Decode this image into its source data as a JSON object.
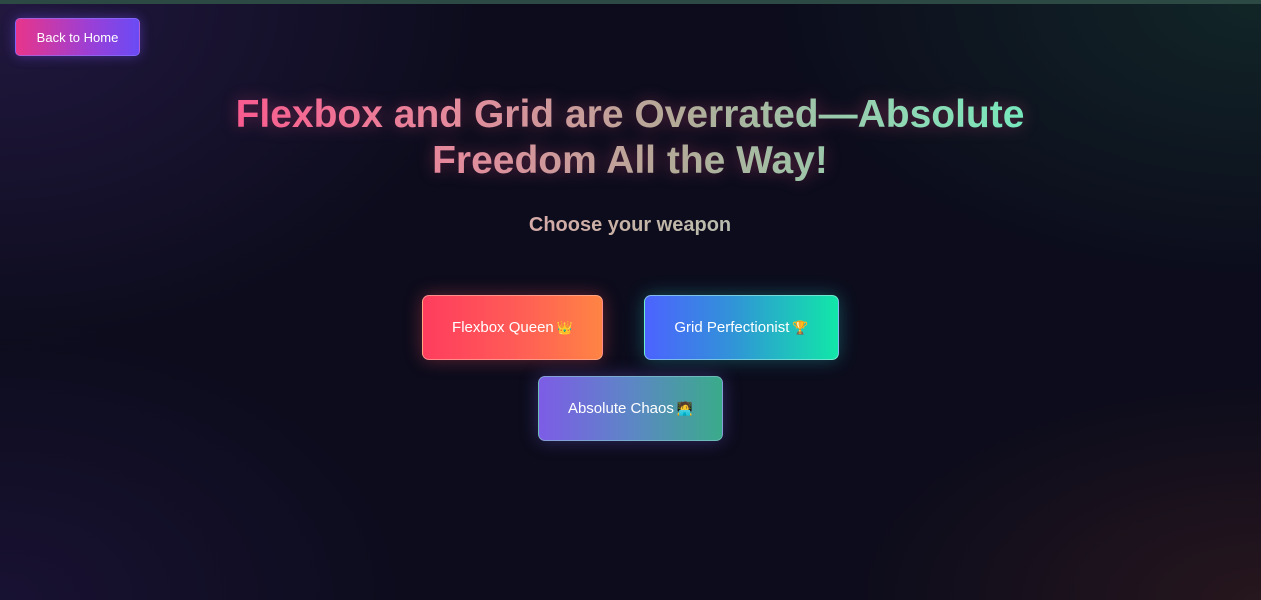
{
  "nav": {
    "back_label": "Back to Home"
  },
  "hero": {
    "title": "Flexbox and Grid are Overrated—Absolute Freedom All the Way!",
    "subtitle": "Choose your weapon"
  },
  "weapons": [
    {
      "label": "Flexbox Queen",
      "icon": "👑",
      "icon_name": "crown-icon"
    },
    {
      "label": "Grid Perfectionist",
      "icon": "🏆",
      "icon_name": "trophy-icon"
    },
    {
      "label": "Absolute Chaos",
      "icon": "🧑‍💻",
      "icon_name": "technologist-icon"
    }
  ],
  "colors": {
    "background": "#0c0c1c",
    "title_gradient_start": "#ff4f8b",
    "title_gradient_end": "#6cf0c0",
    "flexbox_button": "#ff5a57",
    "grid_button": "#11e7a8",
    "chaos_button": "#7d5ce6"
  }
}
